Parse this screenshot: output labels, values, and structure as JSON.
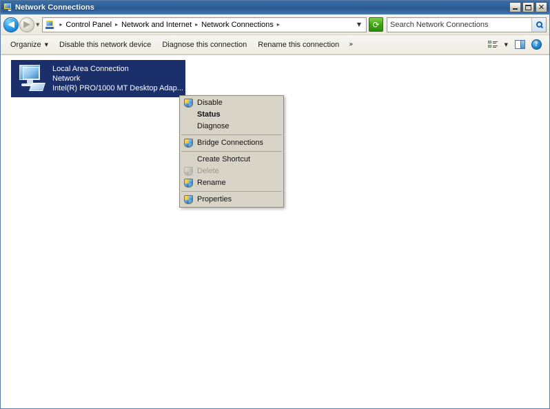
{
  "window": {
    "title": "Network Connections",
    "icon": "network-connections-icon",
    "buttons": {
      "minimize": "_",
      "maximize": "□",
      "close": "✕"
    }
  },
  "addressbar": {
    "back_label": "◀",
    "forward_label": "▶",
    "history_caret": "▼",
    "breadcrumb_icon": "control-panel-icon",
    "breadcrumbs": [
      {
        "label": "Control Panel"
      },
      {
        "label": "Network and Internet"
      },
      {
        "label": "Network Connections"
      }
    ],
    "separator": "▸",
    "overflow_caret": "▼",
    "refresh_label": "⟳",
    "search": {
      "placeholder": "Search Network Connections",
      "value": "",
      "button_icon": "search-icon"
    }
  },
  "toolbar": {
    "items": [
      {
        "label": "Organize",
        "caret": "▼",
        "has_caret": true
      },
      {
        "label": "Disable this network device",
        "has_caret": false
      },
      {
        "label": "Diagnose this connection",
        "has_caret": false
      },
      {
        "label": "Rename this connection",
        "has_caret": false
      }
    ],
    "overflow": "»",
    "right": {
      "view_caret": "▼",
      "help_label": "?"
    }
  },
  "content": {
    "connection": {
      "name": "Local Area Connection",
      "network": "Network",
      "adapter": "Intel(R) PRO/1000 MT Desktop Adap...",
      "selected": true
    }
  },
  "context_menu": {
    "groups": [
      {
        "items": [
          {
            "label": "Disable",
            "icon": "shield-icon",
            "bold": false,
            "disabled": false
          },
          {
            "label": "Status",
            "icon": "none",
            "bold": true,
            "disabled": false
          },
          {
            "label": "Diagnose",
            "icon": "none",
            "bold": false,
            "disabled": false
          }
        ]
      },
      {
        "items": [
          {
            "label": "Bridge Connections",
            "icon": "shield-icon",
            "bold": false,
            "disabled": false
          }
        ]
      },
      {
        "items": [
          {
            "label": "Create Shortcut",
            "icon": "none",
            "bold": false,
            "disabled": false
          },
          {
            "label": "Delete",
            "icon": "shield-icon",
            "bold": false,
            "disabled": true
          },
          {
            "label": "Rename",
            "icon": "shield-icon",
            "bold": false,
            "disabled": false
          }
        ]
      },
      {
        "items": [
          {
            "label": "Properties",
            "icon": "shield-icon",
            "bold": false,
            "disabled": false
          }
        ]
      }
    ]
  },
  "colors": {
    "titlebar_blue": "#2e5f97",
    "selection_blue": "#1b2f6b",
    "toolbar_bg": "#efece2",
    "menu_bg": "#d8d4c8",
    "refresh_green": "#3fa516"
  }
}
